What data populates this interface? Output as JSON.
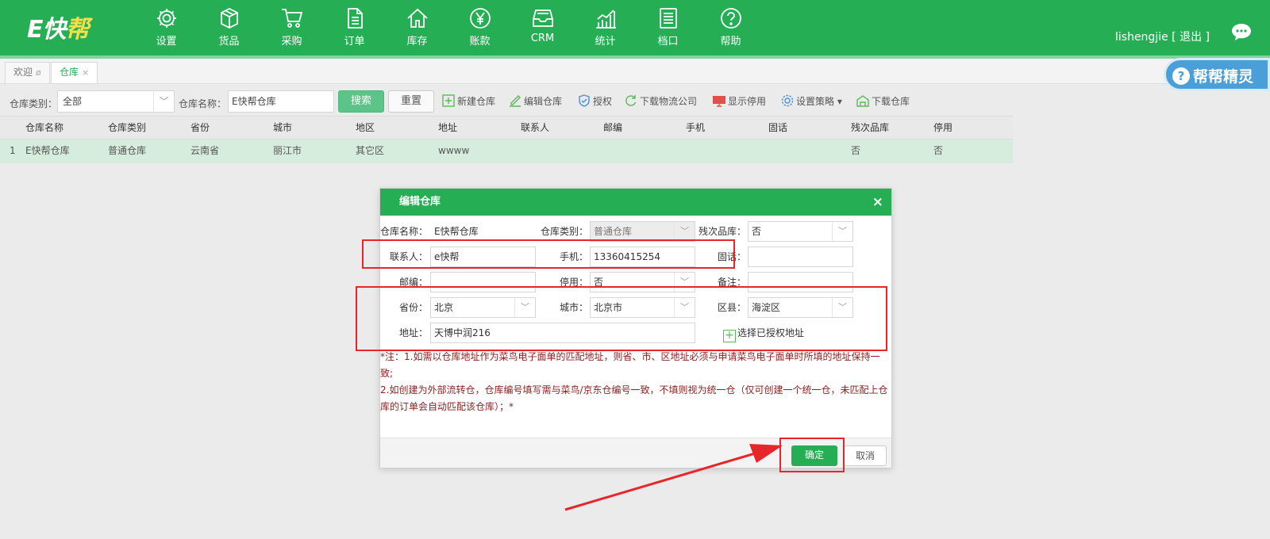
{
  "app": {
    "logo_prefix": "E快",
    "logo_suffix": "帮"
  },
  "nav": [
    {
      "label": "设置",
      "icon": "gear-icon"
    },
    {
      "label": "货品",
      "icon": "box-icon"
    },
    {
      "label": "采购",
      "icon": "cart-icon"
    },
    {
      "label": "订单",
      "icon": "document-icon"
    },
    {
      "label": "库存",
      "icon": "home-icon"
    },
    {
      "label": "账款",
      "icon": "yen-icon"
    },
    {
      "label": "CRM",
      "icon": "inbox-icon"
    },
    {
      "label": "统计",
      "icon": "chart-icon"
    },
    {
      "label": "档口",
      "icon": "list-icon"
    },
    {
      "label": "帮助",
      "icon": "help-icon"
    }
  ],
  "user": {
    "name": "lishengjie",
    "logout": "[ 退出 ]"
  },
  "tabs": [
    {
      "label": "欢迎",
      "close": "ø"
    },
    {
      "label": "仓库",
      "close": "×"
    }
  ],
  "helper": {
    "label": "帮帮精灵",
    "q": "?"
  },
  "toolbar": {
    "type_label": "仓库类别：",
    "type_value": "全部",
    "name_label": "仓库名称：",
    "name_value": "E快帮仓库",
    "search": "搜索",
    "reset": "重置",
    "actions": {
      "new": "新建仓库",
      "edit": "编辑仓库",
      "auth": "授权",
      "download_logistics": "下载物流公司",
      "show_disabled": "显示停用",
      "strategy": "设置策略",
      "download_warehouse": "下载仓库"
    }
  },
  "table": {
    "columns": [
      "仓库名称",
      "仓库类别",
      "省份",
      "城市",
      "地区",
      "地址",
      "联系人",
      "邮编",
      "手机",
      "固话",
      "残次品库",
      "停用"
    ],
    "rows": [
      {
        "index": "1",
        "cells": [
          "E快帮仓库",
          "普通仓库",
          "云南省",
          "丽江市",
          "其它区",
          "wwww",
          "",
          "",
          "",
          "",
          "否",
          "否"
        ]
      }
    ]
  },
  "modal": {
    "title": "编辑仓库",
    "close": "×",
    "fields": {
      "name_label": "仓库名称：",
      "name_value": "E快帮仓库",
      "type_label": "仓库类别：",
      "type_value": "普通仓库",
      "defective_label": "残次品库：",
      "defective_value": "否",
      "contact_label": "联系人：",
      "contact_value": "e快帮",
      "mobile_label": "手机：",
      "mobile_value": "13360415254",
      "phone_label": "固话：",
      "phone_value": "",
      "zip_label": "邮编：",
      "zip_value": "",
      "disabled_label": "停用：",
      "disabled_value": "否",
      "remark_label": "备注：",
      "remark_value": "",
      "province_label": "省份：",
      "province_value": "北京",
      "city_label": "城市：",
      "city_value": "北京市",
      "district_label": "区县：",
      "district_value": "海淀区",
      "address_label": "地址：",
      "address_value": "天博中润216",
      "pick_address": "选择已授权地址"
    },
    "note": [
      "*注：1.如需以仓库地址作为菜鸟电子面单的匹配地址，则省、市、区地址必须与申请菜鸟电子面单时所填的地址保持一致;",
      "2.如创建为外部流转仓，仓库编号填写需与菜鸟/京东仓编号一致，不填则视为统一仓（仅可创建一个统一仓，未匹配上仓库的订单会自动匹配该仓库）；*"
    ],
    "ok": "确定",
    "cancel": "取消"
  },
  "colors": {
    "brand": "#26ae55",
    "annotation": "#e8262a",
    "row_highlight": "#d6ecdc"
  }
}
